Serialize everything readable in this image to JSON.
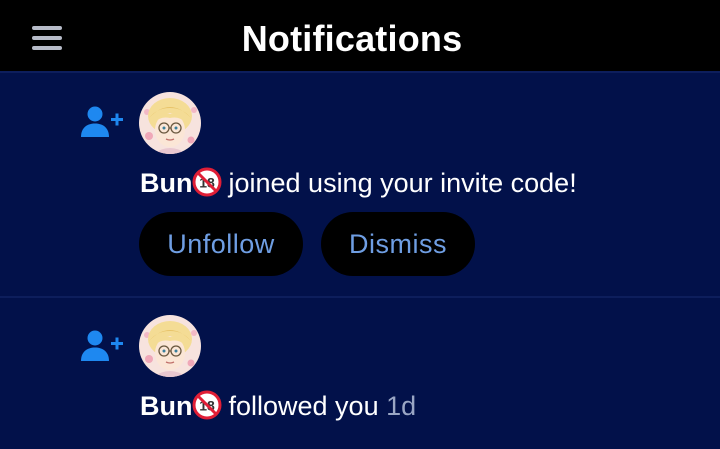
{
  "header": {
    "title": "Notifications",
    "menu_icon": "hamburger-menu-icon"
  },
  "colors": {
    "background": "#02114a",
    "header_background": "#000000",
    "button_background": "#000000",
    "button_text": "#6f9ee3",
    "follow_icon": "#1e88f0",
    "time_text": "#9aa6c4"
  },
  "notifications": [
    {
      "icon": "person-add-icon",
      "user_name": "Bun",
      "name_badge_icon": "no-under-18-icon",
      "message": "joined using your invite code!",
      "actions": [
        "Unfollow",
        "Dismiss"
      ]
    },
    {
      "icon": "person-add-icon",
      "user_name": "Bun",
      "name_badge_icon": "no-under-18-icon",
      "message": "followed you",
      "time": "1d"
    }
  ]
}
